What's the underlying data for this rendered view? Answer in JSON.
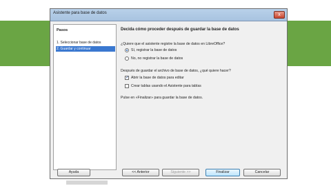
{
  "window": {
    "title": "Asistente para base de datos",
    "close_glyph": "x"
  },
  "steps": {
    "heading": "Pasos",
    "items": [
      {
        "label": "1. Seleccionar base de datos",
        "active": false
      },
      {
        "label": "2. Guardar y continuar",
        "active": true
      }
    ]
  },
  "main": {
    "heading": "Decida cómo proceder después de guardar la base de datos",
    "question1": "¿Quiere que el asistente registre la base de datos en LibreOffice?",
    "radio_yes": "Sí, registrar la base de datos",
    "radio_no": "No, no registrar la base de datos",
    "question2": "Después de guardar el archivo de base de datos, ¿qué quiere hacer?",
    "check_open": "Abrir la base de datos para editar",
    "check_open_checked": true,
    "check_tables": "Crear tablas usando el Asistente para tablas",
    "check_tables_checked": false,
    "footer_text": "Pulse en «Finalizar» para guardar la base de datos."
  },
  "buttons": {
    "help": "Ayuda",
    "back": "<< Anterior",
    "next": "Siguiente >>",
    "finish": "Finalizar",
    "cancel": "Cancelar"
  }
}
